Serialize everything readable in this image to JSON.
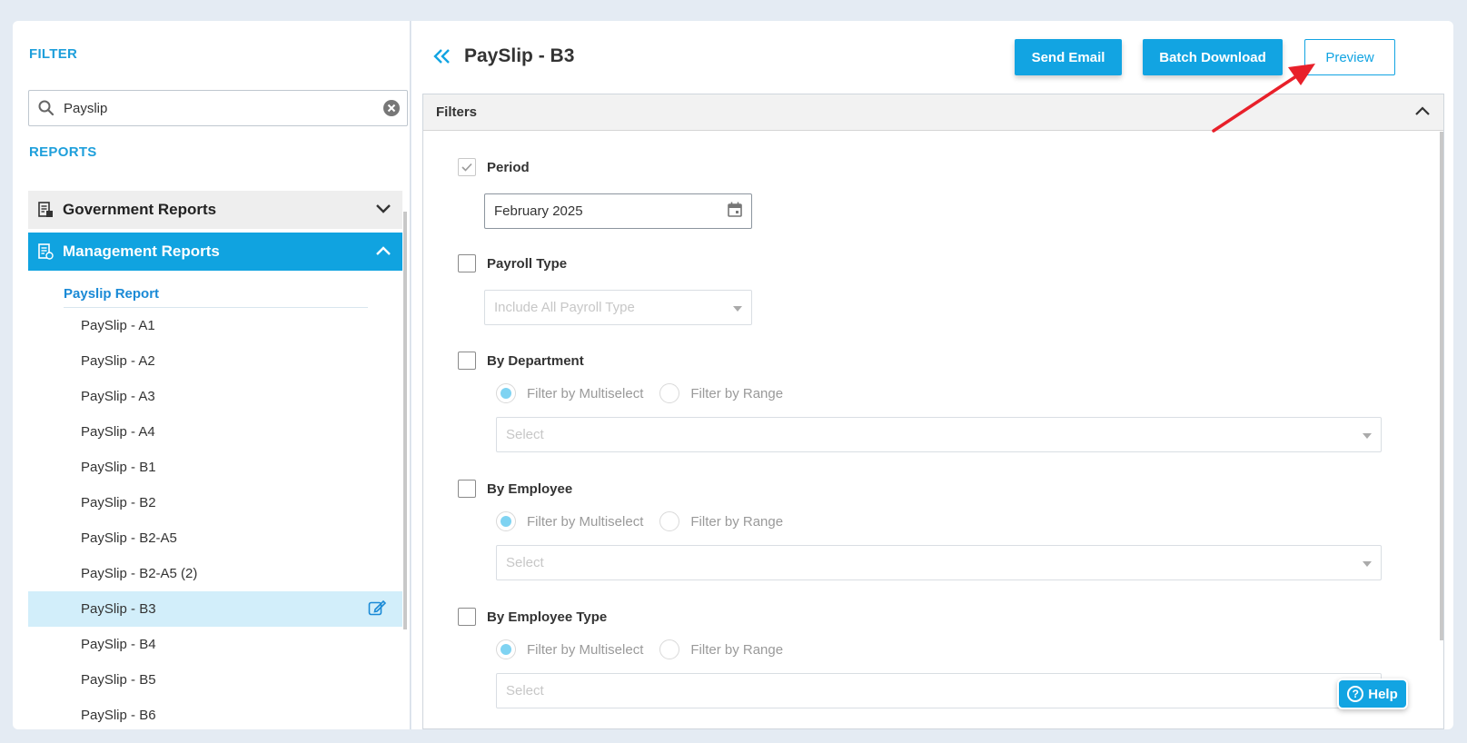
{
  "sidebar": {
    "filter_label": "FILTER",
    "search": {
      "value": "Payslip",
      "placeholder": ""
    },
    "reports_label": "REPORTS",
    "groups": [
      {
        "title": "Government Reports",
        "expanded": false
      },
      {
        "title": "Management Reports",
        "expanded": true
      }
    ],
    "subgroup_title": "Payslip Report",
    "items": [
      {
        "label": "PaySlip - A1"
      },
      {
        "label": "PaySlip - A2"
      },
      {
        "label": "PaySlip - A3"
      },
      {
        "label": "PaySlip - A4"
      },
      {
        "label": "PaySlip - B1"
      },
      {
        "label": "PaySlip - B2"
      },
      {
        "label": "PaySlip - B2-A5"
      },
      {
        "label": "PaySlip - B2-A5 (2)"
      },
      {
        "label": "PaySlip - B3",
        "active": true
      },
      {
        "label": "PaySlip - B4"
      },
      {
        "label": "PaySlip - B5"
      },
      {
        "label": "PaySlip - B6"
      }
    ]
  },
  "header": {
    "title": "PaySlip - B3",
    "send_email": "Send Email",
    "batch_download": "Batch Download",
    "preview": "Preview"
  },
  "filters": {
    "title": "Filters",
    "period": {
      "label": "Period",
      "value": "February 2025",
      "checked": true
    },
    "payroll_type": {
      "label": "Payroll Type",
      "placeholder": "Include All Payroll Type"
    },
    "by_department": {
      "label": "By Department",
      "opt1": "Filter by Multiselect",
      "opt2": "Filter by Range",
      "select": "Select"
    },
    "by_employee": {
      "label": "By Employee",
      "opt1": "Filter by Multiselect",
      "opt2": "Filter by Range",
      "select": "Select"
    },
    "by_employee_type": {
      "label": "By Employee Type",
      "opt1": "Filter by Multiselect",
      "opt2": "Filter by Range",
      "select": "Select"
    }
  },
  "help": {
    "label": "Help"
  },
  "colors": {
    "accent": "#12a4e2",
    "active_row": "#d2eefa",
    "annotation_arrow": "#e8202a"
  }
}
